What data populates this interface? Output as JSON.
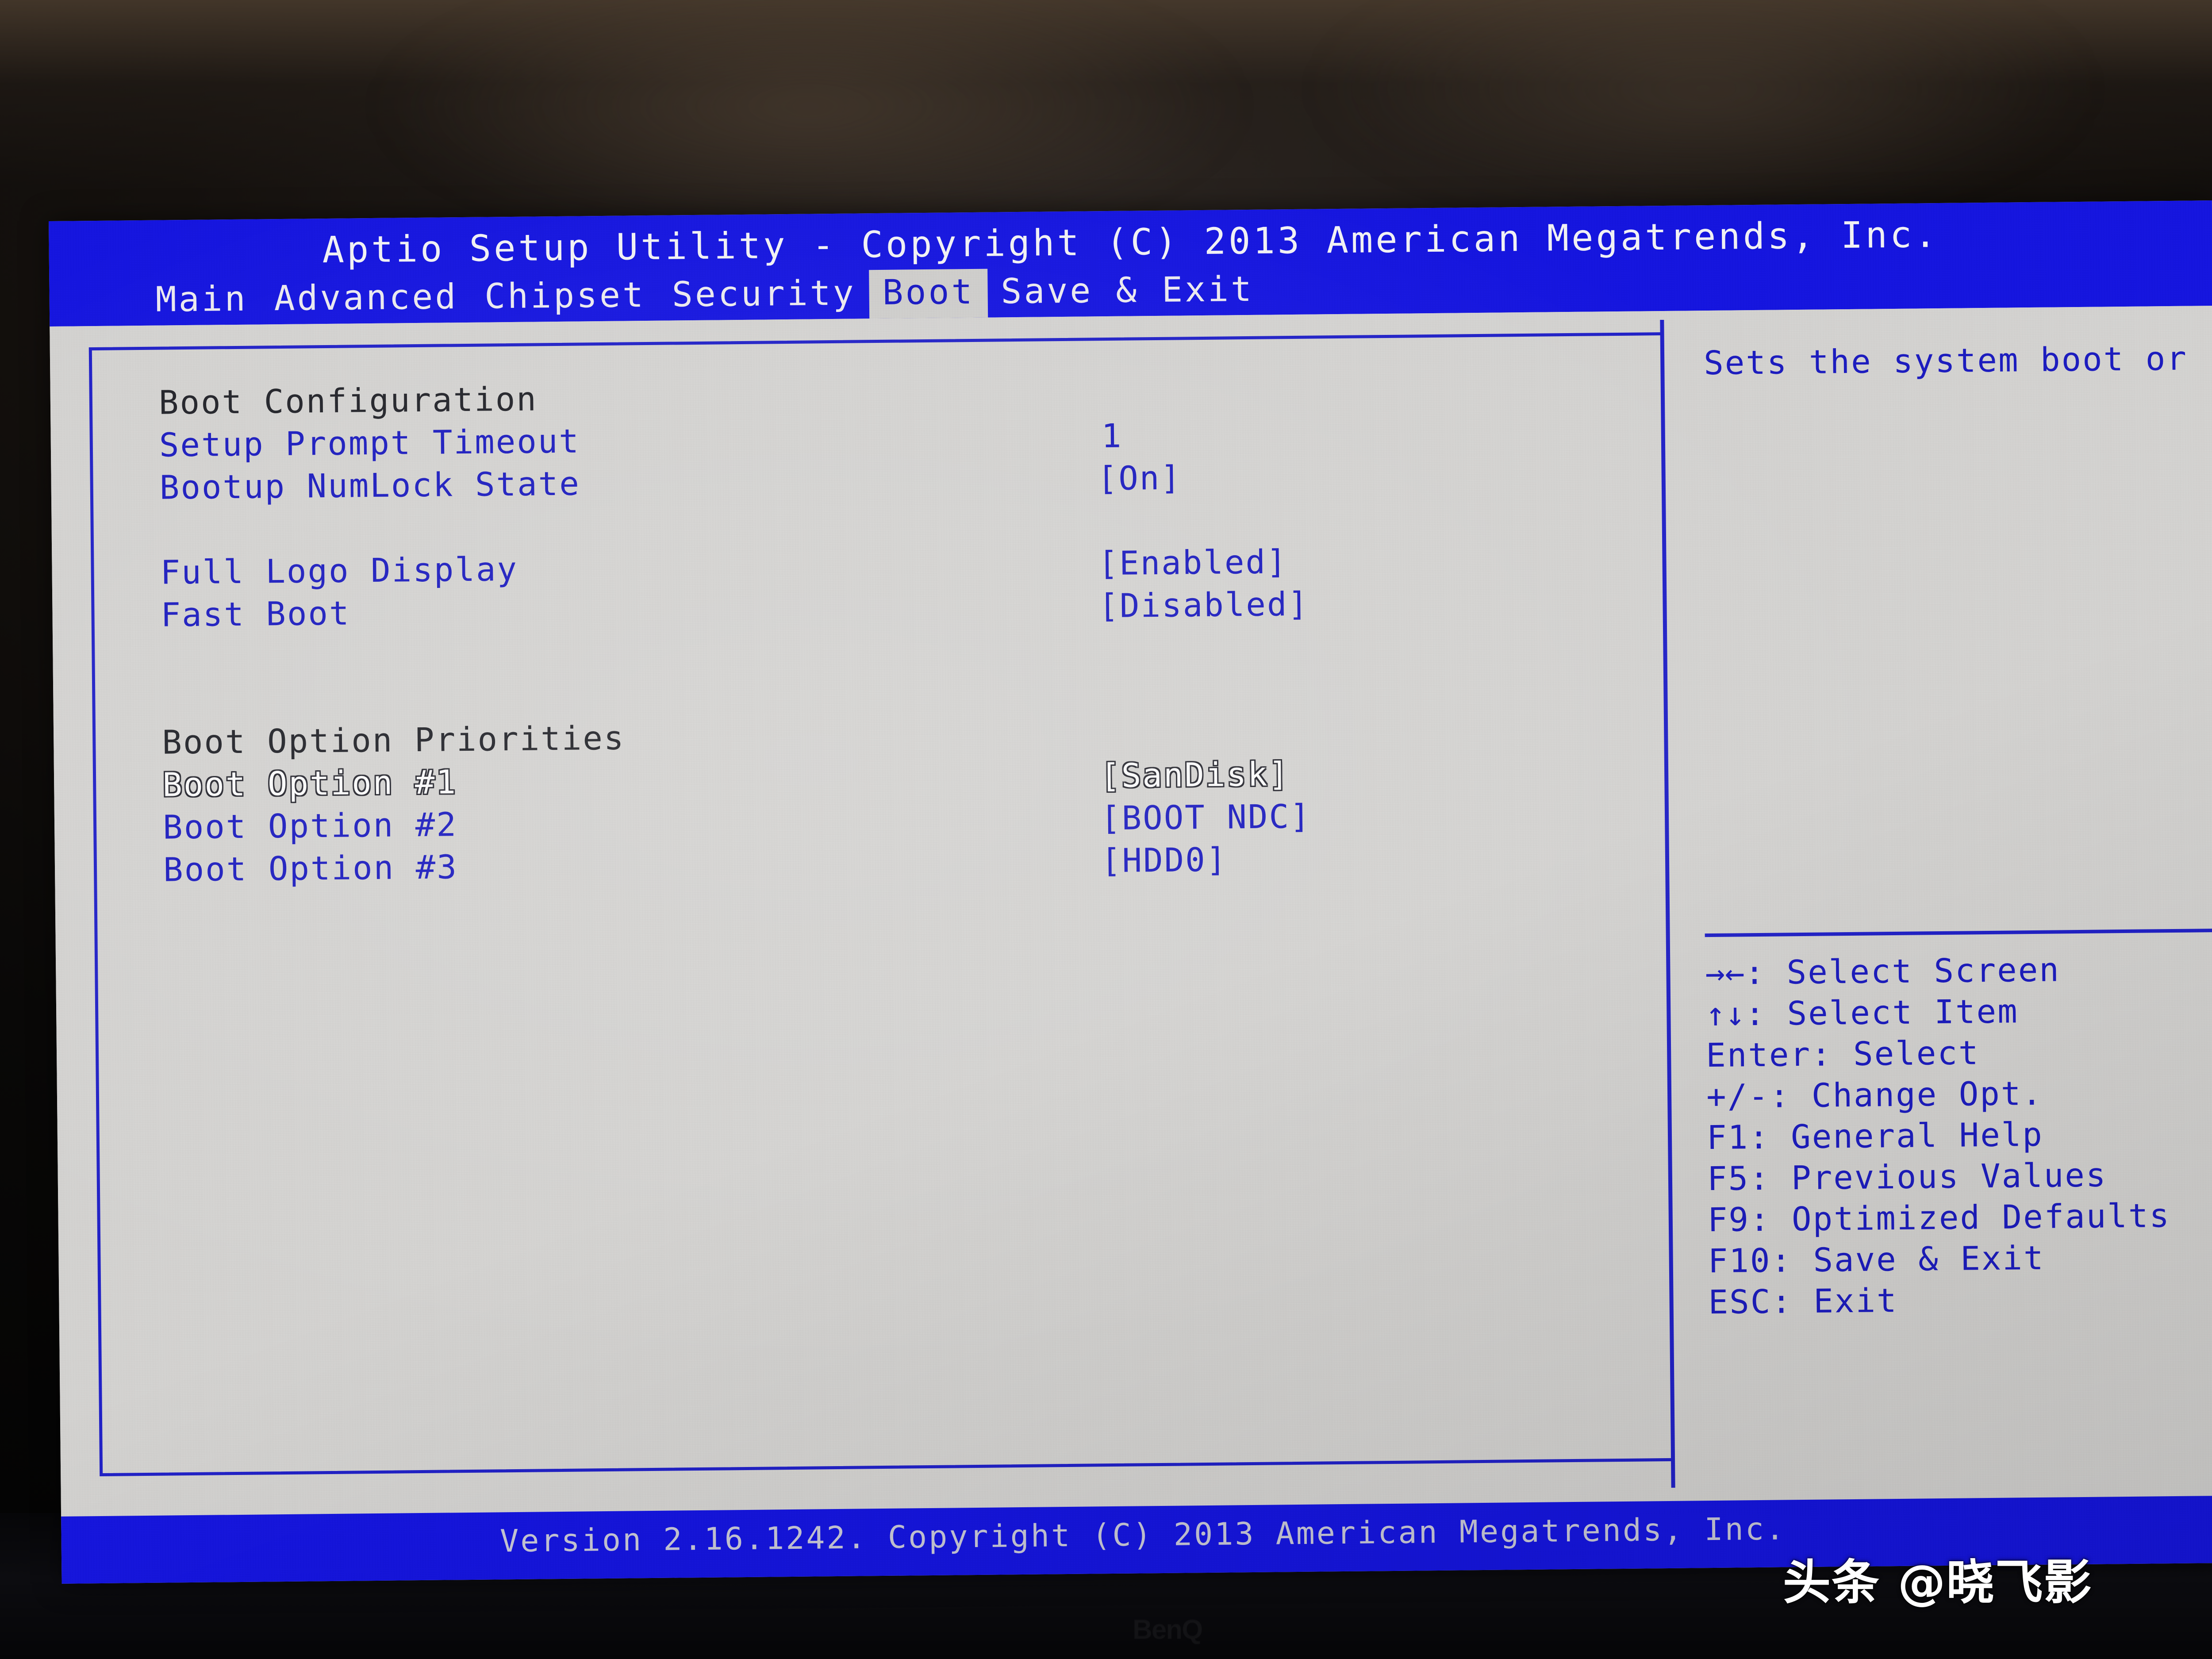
{
  "titlebar": {
    "title": "Aptio Setup Utility - Copyright (C) 2013 American Megatrends, Inc.",
    "tabs": [
      {
        "label": "Main",
        "active": false
      },
      {
        "label": "Advanced",
        "active": false
      },
      {
        "label": "Chipset",
        "active": false
      },
      {
        "label": "Security",
        "active": false
      },
      {
        "label": "Boot",
        "active": true
      },
      {
        "label": "Save & Exit",
        "active": false
      }
    ]
  },
  "main": {
    "rows": [
      {
        "label": "Boot Configuration",
        "value": "",
        "kind": "heading"
      },
      {
        "label": "Setup Prompt Timeout",
        "value": "1",
        "kind": "setting"
      },
      {
        "label": "Bootup NumLock State",
        "value": "[On]",
        "kind": "setting"
      },
      {
        "label": "",
        "value": "",
        "kind": "spacer"
      },
      {
        "label": "Full Logo Display",
        "value": "[Enabled]",
        "kind": "setting"
      },
      {
        "label": "Fast Boot",
        "value": "[Disabled]",
        "kind": "setting"
      },
      {
        "label": "",
        "value": "",
        "kind": "spacer"
      },
      {
        "label": "",
        "value": "",
        "kind": "spacer"
      },
      {
        "label": "Boot Option Priorities",
        "value": "",
        "kind": "heading"
      },
      {
        "label": "Boot Option #1",
        "value": "[SanDisk]",
        "kind": "selected"
      },
      {
        "label": "Boot Option #2",
        "value": "[BOOT NDC]",
        "kind": "setting"
      },
      {
        "label": "Boot Option #3",
        "value": "[HDD0]",
        "kind": "setting"
      }
    ]
  },
  "help": {
    "description": "Sets the system boot or",
    "legend": [
      {
        "glyph": "→←",
        "text": ": Select Screen"
      },
      {
        "glyph": "↑↓",
        "text": ": Select Item"
      },
      {
        "glyph": "",
        "text": "Enter: Select"
      },
      {
        "glyph": "",
        "text": "+/-: Change Opt."
      },
      {
        "glyph": "",
        "text": "F1: General Help"
      },
      {
        "glyph": "",
        "text": "F5: Previous Values"
      },
      {
        "glyph": "",
        "text": "F9: Optimized Defaults"
      },
      {
        "glyph": "",
        "text": "F10: Save & Exit"
      },
      {
        "glyph": "",
        "text": "ESC: Exit"
      }
    ]
  },
  "footer": {
    "version": "Version 2.16.1242. Copyright (C) 2013 American Megatrends, Inc."
  },
  "overlay": {
    "watermark": "头条 @晓飞影",
    "monitor_brand": "BenQ"
  },
  "colors": {
    "bios_blue": "#1616e0",
    "text_blue": "#1d1dc0",
    "panel_gray": "#d4d3d1",
    "heading_dark": "#23242a",
    "selected_white": "#fbfbfb"
  }
}
